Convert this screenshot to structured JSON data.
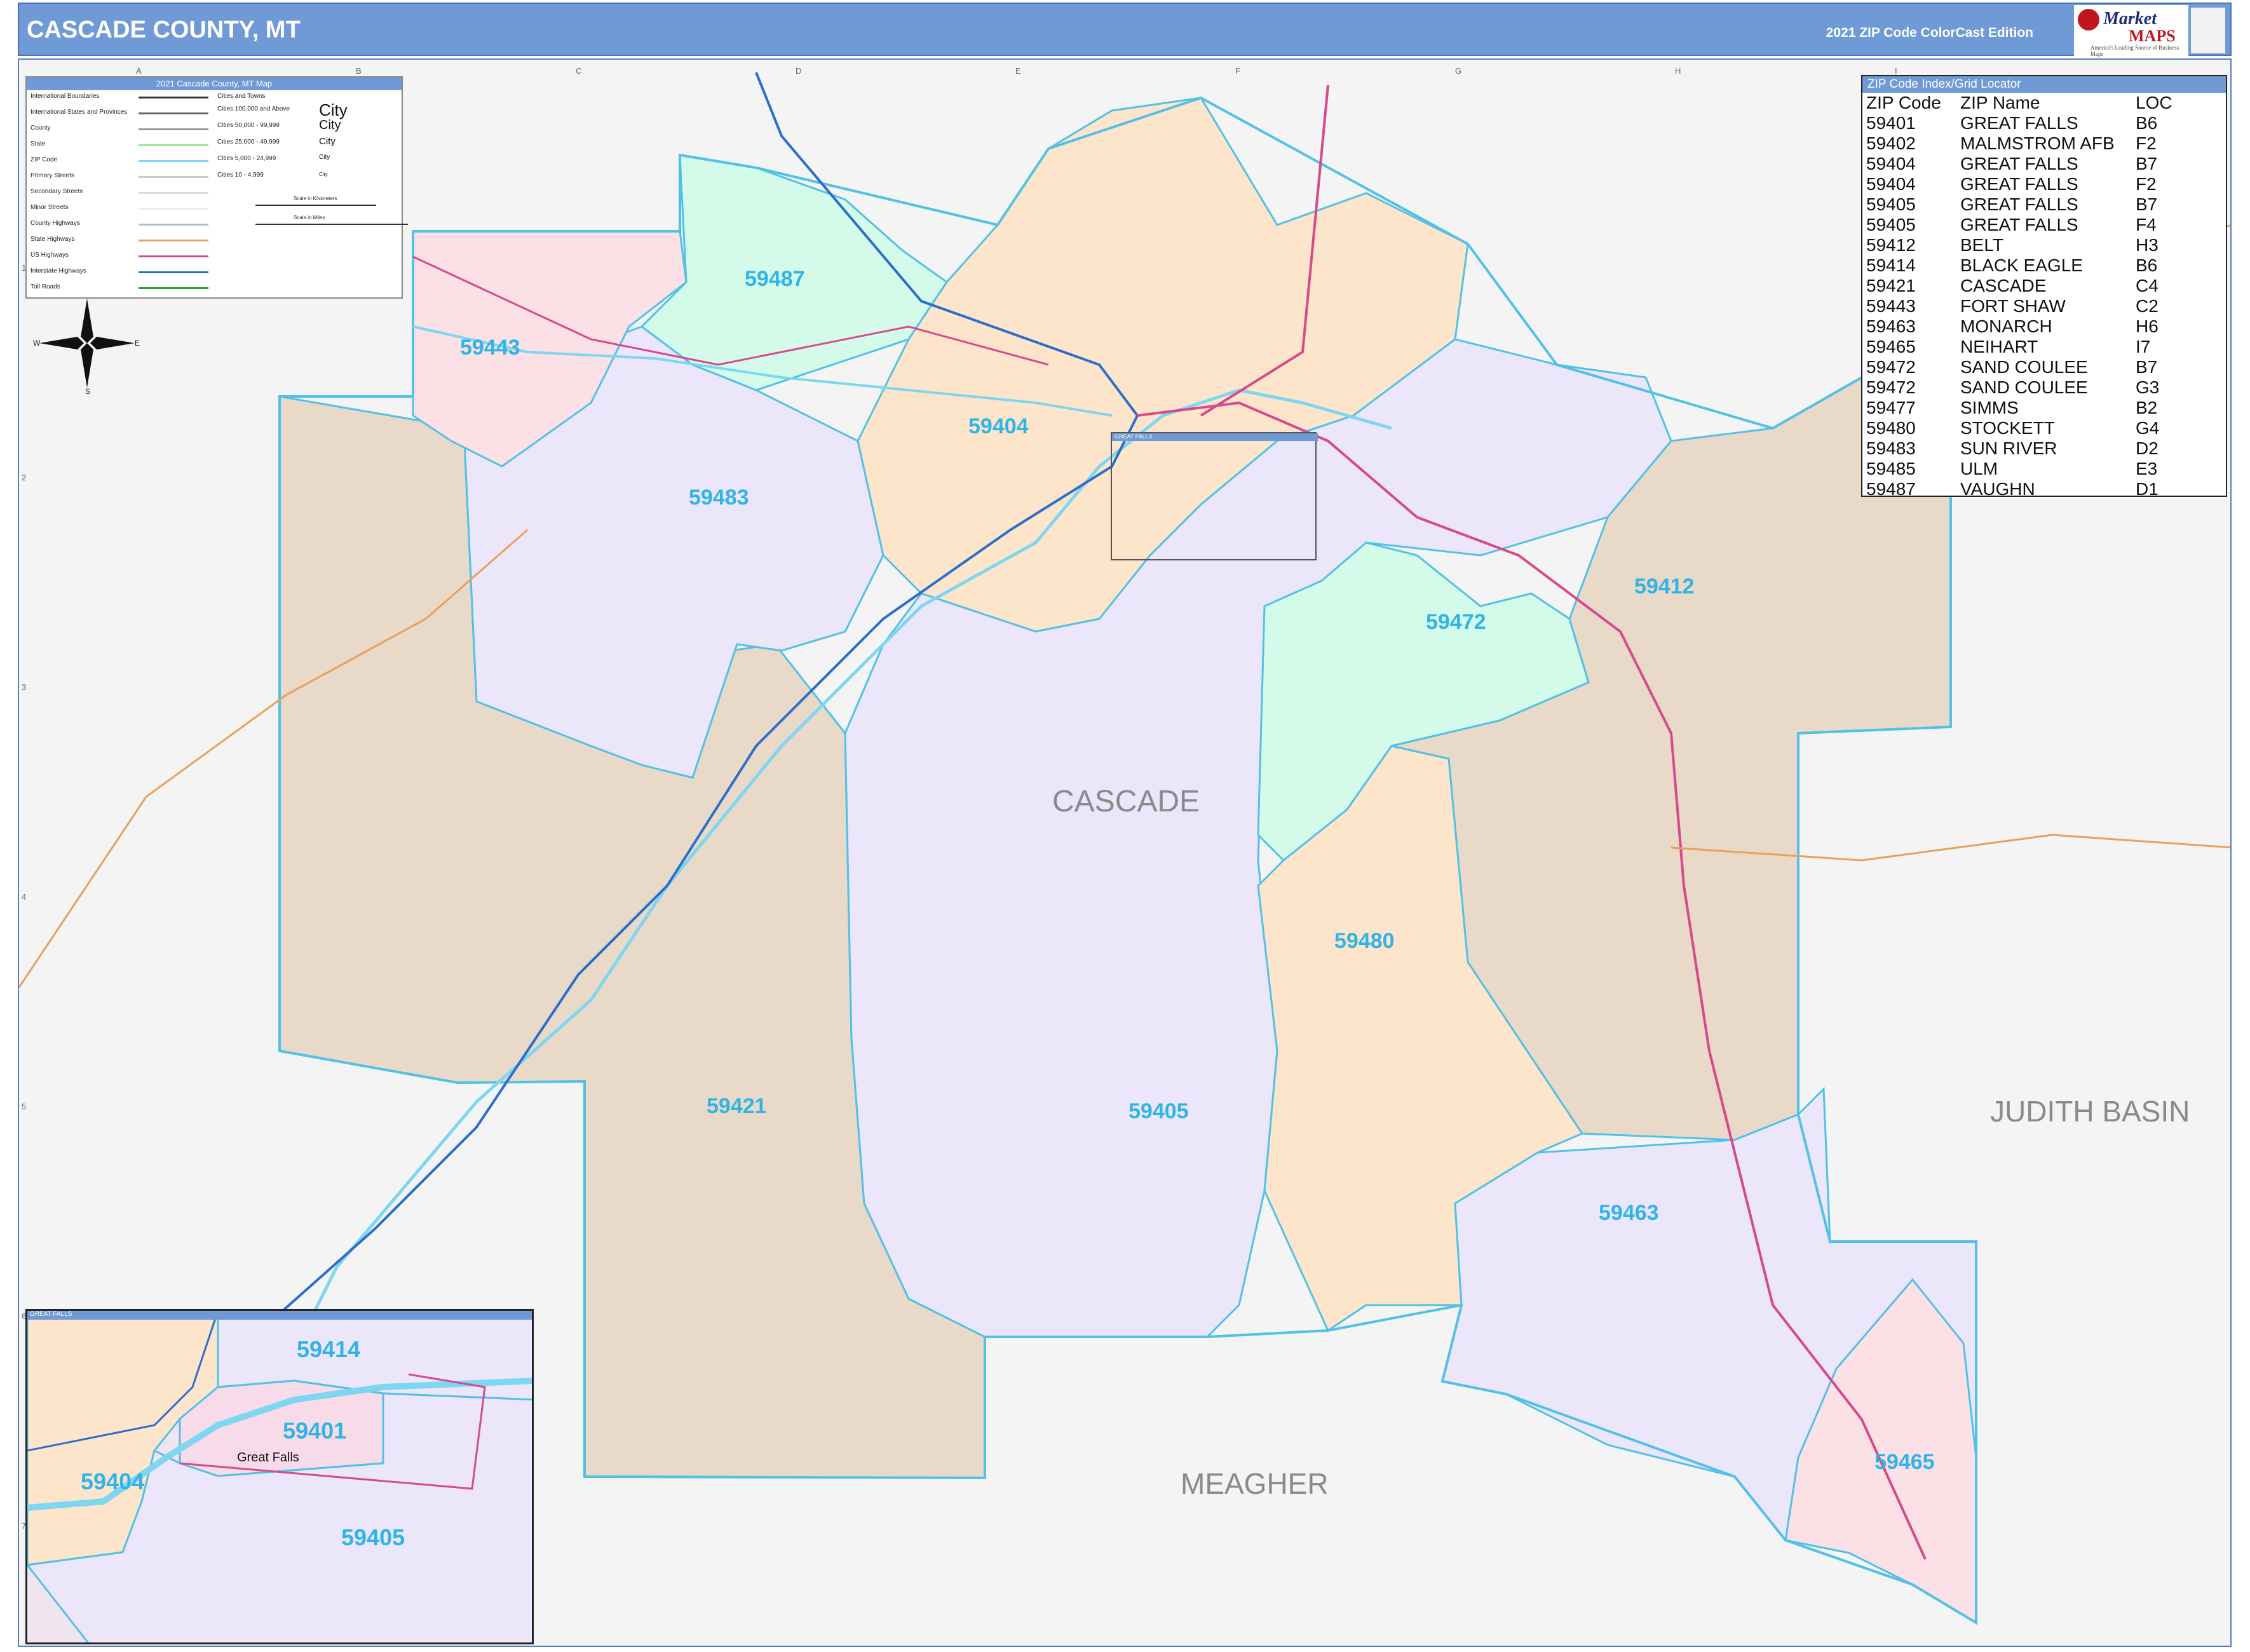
{
  "header": {
    "title": "CASCADE COUNTY, MT",
    "edition": "2021 ZIP Code ColorCast Edition",
    "logo_name": "Market",
    "logo_name2": "MAPS",
    "logo_tagline": "America's Leading Source of Business Maps"
  },
  "grid": {
    "columns": [
      "A",
      "B",
      "C",
      "D",
      "E",
      "F",
      "G",
      "H",
      "I"
    ],
    "rows": [
      "1",
      "2",
      "3",
      "4",
      "5",
      "6",
      "7",
      "8"
    ]
  },
  "legend": {
    "title": "2021 Cascade County, MT Map",
    "items": [
      {
        "label": "International Boundaries",
        "color": "#333333"
      },
      {
        "label": "International States and Provinces",
        "color": "#666666"
      },
      {
        "label": "County",
        "color": "#999999"
      },
      {
        "label": "State",
        "color": "#9be89b"
      },
      {
        "label": "ZIP Code",
        "color": "#7fd6f0"
      },
      {
        "label": "Primary Streets",
        "color": "#cccccc"
      },
      {
        "label": "Secondary Streets",
        "color": "#dddddd"
      },
      {
        "label": "Minor Streets",
        "color": "#eeeeee"
      },
      {
        "label": "County Highways",
        "color": "#bbbbbb"
      },
      {
        "label": "State Highways",
        "color": "#e8a05a"
      },
      {
        "label": "US Highways",
        "color": "#d64a8c"
      },
      {
        "label": "Interstate Highways",
        "color": "#2c6fc9"
      },
      {
        "label": "Toll Roads",
        "color": "#2aa02a"
      }
    ],
    "cities_header": "Cities and Towns",
    "cities": [
      {
        "label": "Cities 100,000 and Above",
        "sample": "City"
      },
      {
        "label": "Cities 50,000 - 99,999",
        "sample": "City"
      },
      {
        "label": "Cities 25,000 - 49,999",
        "sample": "City"
      },
      {
        "label": "Cities 5,000 - 24,999",
        "sample": "City"
      },
      {
        "label": "Cities 10 - 4,999",
        "sample": "City"
      }
    ],
    "scale_km": "Scale in Kilometers",
    "scale_mi": "Scale in Miles"
  },
  "zip_index": {
    "title": "ZIP Code Index/Grid Locator",
    "columns": [
      "ZIP Code",
      "ZIP Name",
      "LOC"
    ],
    "rows": [
      [
        "59401",
        "GREAT FALLS",
        "B6"
      ],
      [
        "59402",
        "MALMSTROM AFB",
        "F2"
      ],
      [
        "59404",
        "GREAT FALLS",
        "B7"
      ],
      [
        "59404",
        "GREAT FALLS",
        "F2"
      ],
      [
        "59405",
        "GREAT FALLS",
        "B7"
      ],
      [
        "59405",
        "GREAT FALLS",
        "F4"
      ],
      [
        "59412",
        "BELT",
        "H3"
      ],
      [
        "59414",
        "BLACK EAGLE",
        "B6"
      ],
      [
        "59421",
        "CASCADE",
        "C4"
      ],
      [
        "59443",
        "FORT SHAW",
        "C2"
      ],
      [
        "59463",
        "MONARCH",
        "H6"
      ],
      [
        "59465",
        "NEIHART",
        "I7"
      ],
      [
        "59472",
        "SAND COULEE",
        "B7"
      ],
      [
        "59472",
        "SAND COULEE",
        "G3"
      ],
      [
        "59477",
        "SIMMS",
        "B2"
      ],
      [
        "59480",
        "STOCKETT",
        "G4"
      ],
      [
        "59483",
        "SUN RIVER",
        "D2"
      ],
      [
        "59485",
        "ULM",
        "E3"
      ],
      [
        "59487",
        "VAUGHN",
        "D1"
      ]
    ]
  },
  "map": {
    "county_name": "CASCADE",
    "adjacent_counties": [
      "JUDITH BASIN",
      "MEAGHER"
    ],
    "zip_labels": [
      "59487",
      "59443",
      "59404",
      "59483",
      "59412",
      "59472",
      "59480",
      "59421",
      "59405",
      "59463",
      "59465"
    ],
    "colors": {
      "tan": "#e8d9c8",
      "lavender": "#ece6fa",
      "peach": "#fde5cc",
      "mint": "#d4fbea",
      "pink": "#fbe0e6",
      "zip_border": "#52c1e6",
      "interstate": "#2c6fc9",
      "us_highway": "#d64a8c",
      "state_highway": "#e8a05a",
      "river": "#7fd6f0"
    },
    "great_falls_label": "GREAT FALLS"
  },
  "inset": {
    "title": "GREAT FALLS",
    "zip_labels": [
      "59414",
      "59401",
      "59404",
      "59405"
    ],
    "city": "Great Falls"
  }
}
